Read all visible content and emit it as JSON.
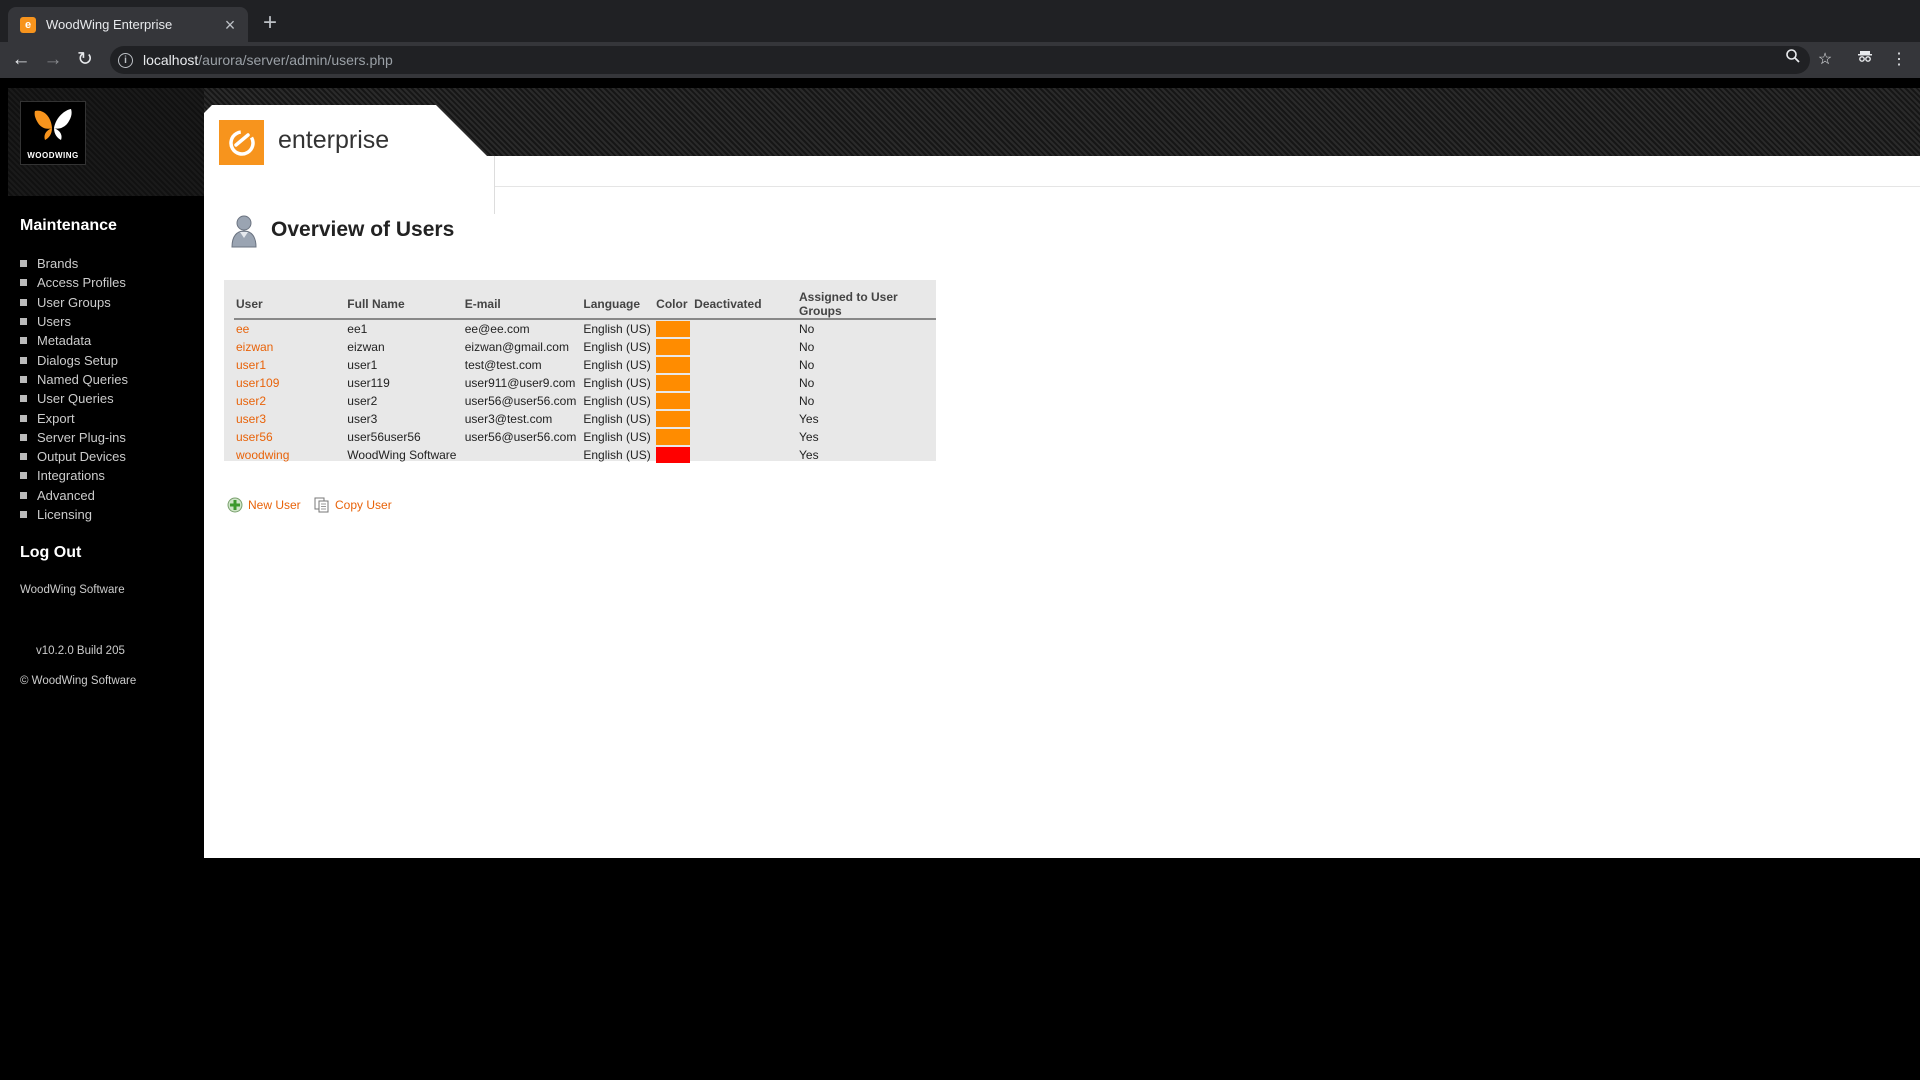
{
  "browser": {
    "tab_title": "WoodWing Enterprise",
    "tab_close": "×",
    "new_tab": "+",
    "url_host": "localhost",
    "url_path": "/aurora/server/admin/users.php"
  },
  "brand": {
    "logo_text": "WOODWING",
    "product_name": "enterprise",
    "accent_color": "#f7941d"
  },
  "sidebar": {
    "maintenance_heading": "Maintenance",
    "items": [
      {
        "label": "Brands"
      },
      {
        "label": "Access Profiles"
      },
      {
        "label": "User Groups"
      },
      {
        "label": "Users"
      },
      {
        "label": "Metadata"
      },
      {
        "label": "Dialogs Setup"
      },
      {
        "label": "Named Queries"
      },
      {
        "label": "User Queries"
      },
      {
        "label": "Export"
      },
      {
        "label": "Server Plug-ins"
      },
      {
        "label": "Output Devices"
      },
      {
        "label": "Integrations"
      },
      {
        "label": "Advanced"
      },
      {
        "label": "Licensing"
      }
    ],
    "logout": "Log Out",
    "company": "WoodWing Software",
    "version": "v10.2.0 Build 205",
    "copyright": "© WoodWing Software"
  },
  "main": {
    "title": "Overview of Users",
    "columns": [
      "User",
      "Full Name",
      "E-mail",
      "Language",
      "Color",
      "Deactivated",
      "Assigned to User Groups"
    ],
    "rows": [
      {
        "user": "ee",
        "full_name": "ee1",
        "email": "ee@ee.com",
        "language": "English (US)",
        "color": "#ff8c00",
        "deactivated": "",
        "assigned": "No"
      },
      {
        "user": "eizwan",
        "full_name": "eizwan",
        "email": "eizwan@gmail.com",
        "language": "English (US)",
        "color": "#ff8c00",
        "deactivated": "",
        "assigned": "No"
      },
      {
        "user": "user1",
        "full_name": "user1",
        "email": "test@test.com",
        "language": "English (US)",
        "color": "#ff8c00",
        "deactivated": "",
        "assigned": "No"
      },
      {
        "user": "user109",
        "full_name": "user119",
        "email": "user911@user9.com",
        "language": "English (US)",
        "color": "#ff8c00",
        "deactivated": "",
        "assigned": "No"
      },
      {
        "user": "user2",
        "full_name": "user2",
        "email": "user56@user56.com",
        "language": "English (US)",
        "color": "#ff8c00",
        "deactivated": "",
        "assigned": "No"
      },
      {
        "user": "user3",
        "full_name": "user3",
        "email": "user3@test.com",
        "language": "English (US)",
        "color": "#ff8c00",
        "deactivated": "",
        "assigned": "Yes"
      },
      {
        "user": "user56",
        "full_name": "user56user56",
        "email": "user56@user56.com",
        "language": "English (US)",
        "color": "#ff8c00",
        "deactivated": "",
        "assigned": "Yes"
      },
      {
        "user": "woodwing",
        "full_name": "WoodWing Software",
        "email": "",
        "language": "English (US)",
        "color": "#ff0000",
        "deactivated": "",
        "assigned": "Yes"
      }
    ],
    "actions": {
      "new_user": "New User",
      "copy_user": "Copy User"
    }
  }
}
